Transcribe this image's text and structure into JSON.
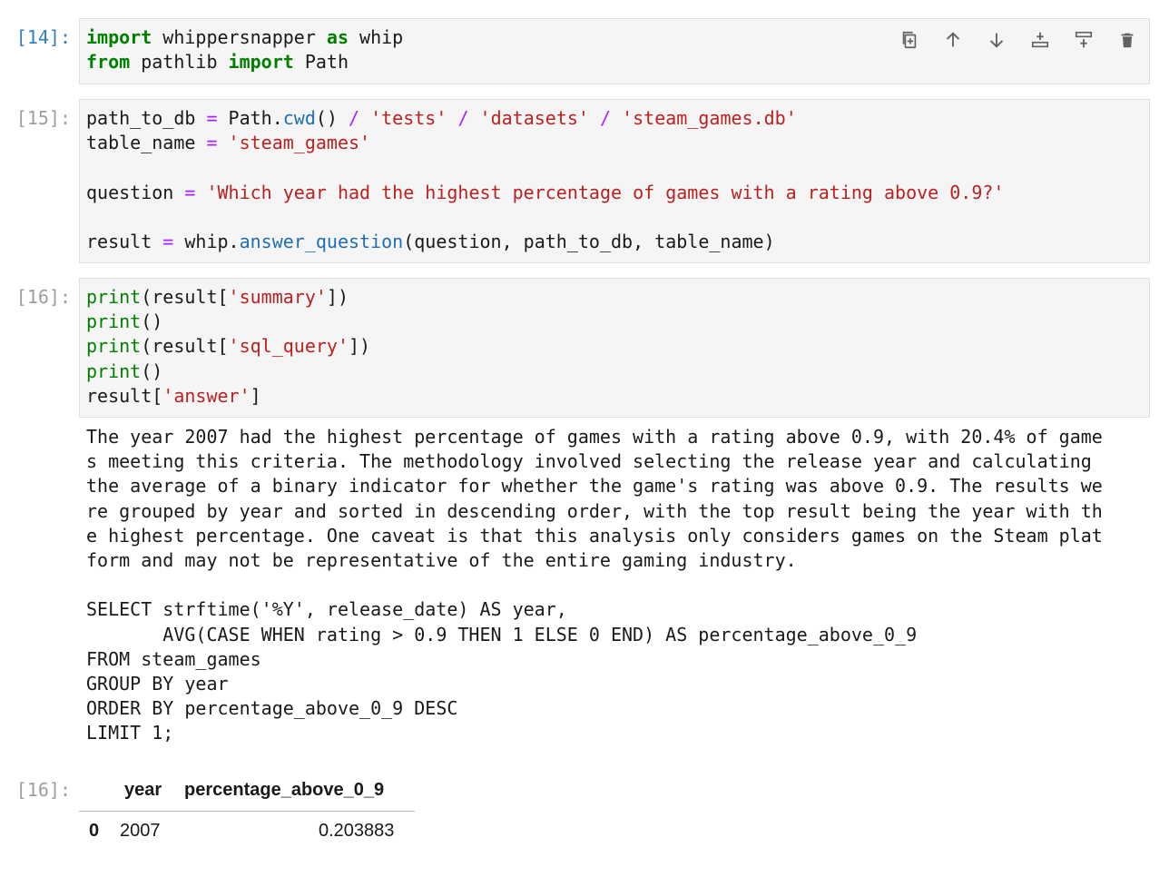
{
  "cells": [
    {
      "prompt": "[14]:",
      "lines": [
        [
          {
            "t": "import",
            "c": "kw"
          },
          {
            "t": " whippersnapper ",
            "c": ""
          },
          {
            "t": "as",
            "c": "kw"
          },
          {
            "t": " whip",
            "c": ""
          }
        ],
        [
          {
            "t": "from",
            "c": "kw"
          },
          {
            "t": " pathlib ",
            "c": ""
          },
          {
            "t": "import",
            "c": "kw"
          },
          {
            "t": " Path",
            "c": ""
          }
        ]
      ]
    },
    {
      "prompt": "[15]:",
      "lines": [
        [
          {
            "t": "path_to_db ",
            "c": ""
          },
          {
            "t": "=",
            "c": "op"
          },
          {
            "t": " Path.",
            "c": ""
          },
          {
            "t": "cwd",
            "c": "fn"
          },
          {
            "t": "() ",
            "c": ""
          },
          {
            "t": "/",
            "c": "op"
          },
          {
            "t": " ",
            "c": ""
          },
          {
            "t": "'tests'",
            "c": "str"
          },
          {
            "t": " ",
            "c": ""
          },
          {
            "t": "/",
            "c": "op"
          },
          {
            "t": " ",
            "c": ""
          },
          {
            "t": "'datasets'",
            "c": "str"
          },
          {
            "t": " ",
            "c": ""
          },
          {
            "t": "/",
            "c": "op"
          },
          {
            "t": " ",
            "c": ""
          },
          {
            "t": "'steam_games.db'",
            "c": "str"
          }
        ],
        [
          {
            "t": "table_name ",
            "c": ""
          },
          {
            "t": "=",
            "c": "op"
          },
          {
            "t": " ",
            "c": ""
          },
          {
            "t": "'steam_games'",
            "c": "str"
          }
        ],
        [],
        [
          {
            "t": "question ",
            "c": ""
          },
          {
            "t": "=",
            "c": "op"
          },
          {
            "t": " ",
            "c": ""
          },
          {
            "t": "'Which year had the highest percentage of games with a rating above 0.9?'",
            "c": "str"
          }
        ],
        [],
        [
          {
            "t": "result ",
            "c": ""
          },
          {
            "t": "=",
            "c": "op"
          },
          {
            "t": " whip.",
            "c": ""
          },
          {
            "t": "answer_question",
            "c": "fn"
          },
          {
            "t": "(question, path_to_db, table_name)",
            "c": ""
          }
        ]
      ]
    },
    {
      "prompt": "[16]:",
      "lines": [
        [
          {
            "t": "print",
            "c": "bi"
          },
          {
            "t": "(result[",
            "c": ""
          },
          {
            "t": "'summary'",
            "c": "str"
          },
          {
            "t": "])",
            "c": ""
          }
        ],
        [
          {
            "t": "print",
            "c": "bi"
          },
          {
            "t": "()",
            "c": ""
          }
        ],
        [
          {
            "t": "print",
            "c": "bi"
          },
          {
            "t": "(result[",
            "c": ""
          },
          {
            "t": "'sql_query'",
            "c": "str"
          },
          {
            "t": "])",
            "c": ""
          }
        ],
        [
          {
            "t": "print",
            "c": "bi"
          },
          {
            "t": "()",
            "c": ""
          }
        ],
        [
          {
            "t": "result[",
            "c": ""
          },
          {
            "t": "'answer'",
            "c": "str"
          },
          {
            "t": "]",
            "c": ""
          }
        ]
      ]
    }
  ],
  "toolbar": {
    "icons": [
      "duplicate-icon",
      "move-up-icon",
      "move-down-icon",
      "insert-above-icon",
      "insert-below-icon",
      "delete-icon"
    ]
  },
  "output": {
    "stdout_lines": [
      "The year 2007 had the highest percentage of games with a rating above 0.9, with 20.4% of game",
      "s meeting this criteria. The methodology involved selecting the release year and calculating",
      "the average of a binary indicator for whether the game's rating was above 0.9. The results we",
      "re grouped by year and sorted in descending order, with the top result being the year with th",
      "e highest percentage. One caveat is that this analysis only considers games on the Steam plat",
      "form and may not be representative of the entire gaming industry.",
      "",
      "SELECT strftime('%Y', release_date) AS year,",
      "       AVG(CASE WHEN rating > 0.9 THEN 1 ELSE 0 END) AS percentage_above_0_9",
      "FROM steam_games",
      "GROUP BY year",
      "ORDER BY percentage_above_0_9 DESC",
      "LIMIT 1;"
    ],
    "result_prompt": "[16]:",
    "table": {
      "columns": [
        "year",
        "percentage_above_0_9"
      ],
      "rows": [
        {
          "index": "0",
          "year": "2007",
          "percentage_above_0_9": "0.203883"
        }
      ]
    }
  }
}
